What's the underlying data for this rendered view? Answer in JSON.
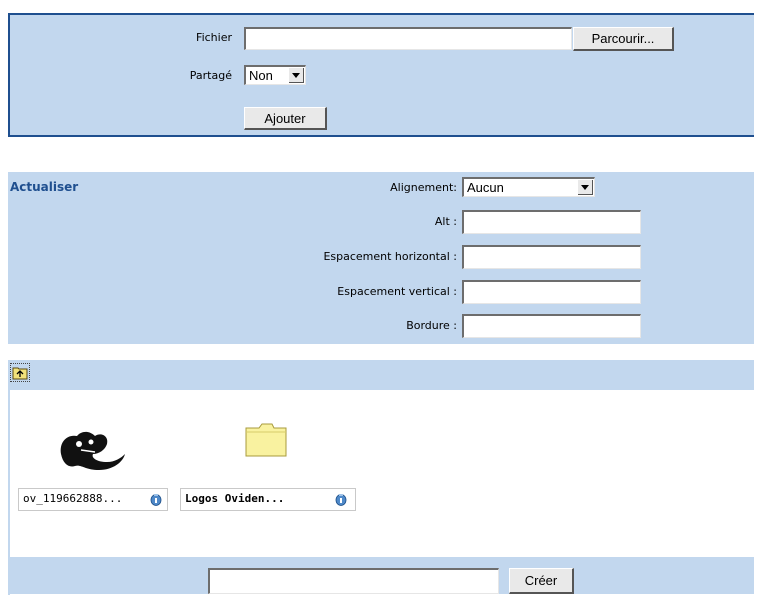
{
  "upload": {
    "file_label": "Fichier",
    "file_value": "",
    "browse_label": "Parcourir...",
    "shared_label": "Partagé",
    "shared_value": "Non",
    "add_label": "Ajouter"
  },
  "properties": {
    "refresh_label": "Actualiser",
    "alignment_label": "Alignement:",
    "alignment_value": "Aucun",
    "alt_label": "Alt :",
    "hspace_label": "Espacement horizontal :",
    "vspace_label": "Espacement vertical :",
    "border_label": "Bordure :"
  },
  "browser": {
    "items": [
      {
        "name": "ov_119662888...",
        "icon": "logo-image-thumbnail"
      },
      {
        "name": "Logos Oviden...",
        "icon": "folder-icon"
      }
    ],
    "create_input_value": "",
    "create_label": "Créer"
  },
  "colors": {
    "panel": "#c2d7ee",
    "border": "#1f4f8f",
    "link": "#1f4f8f"
  }
}
